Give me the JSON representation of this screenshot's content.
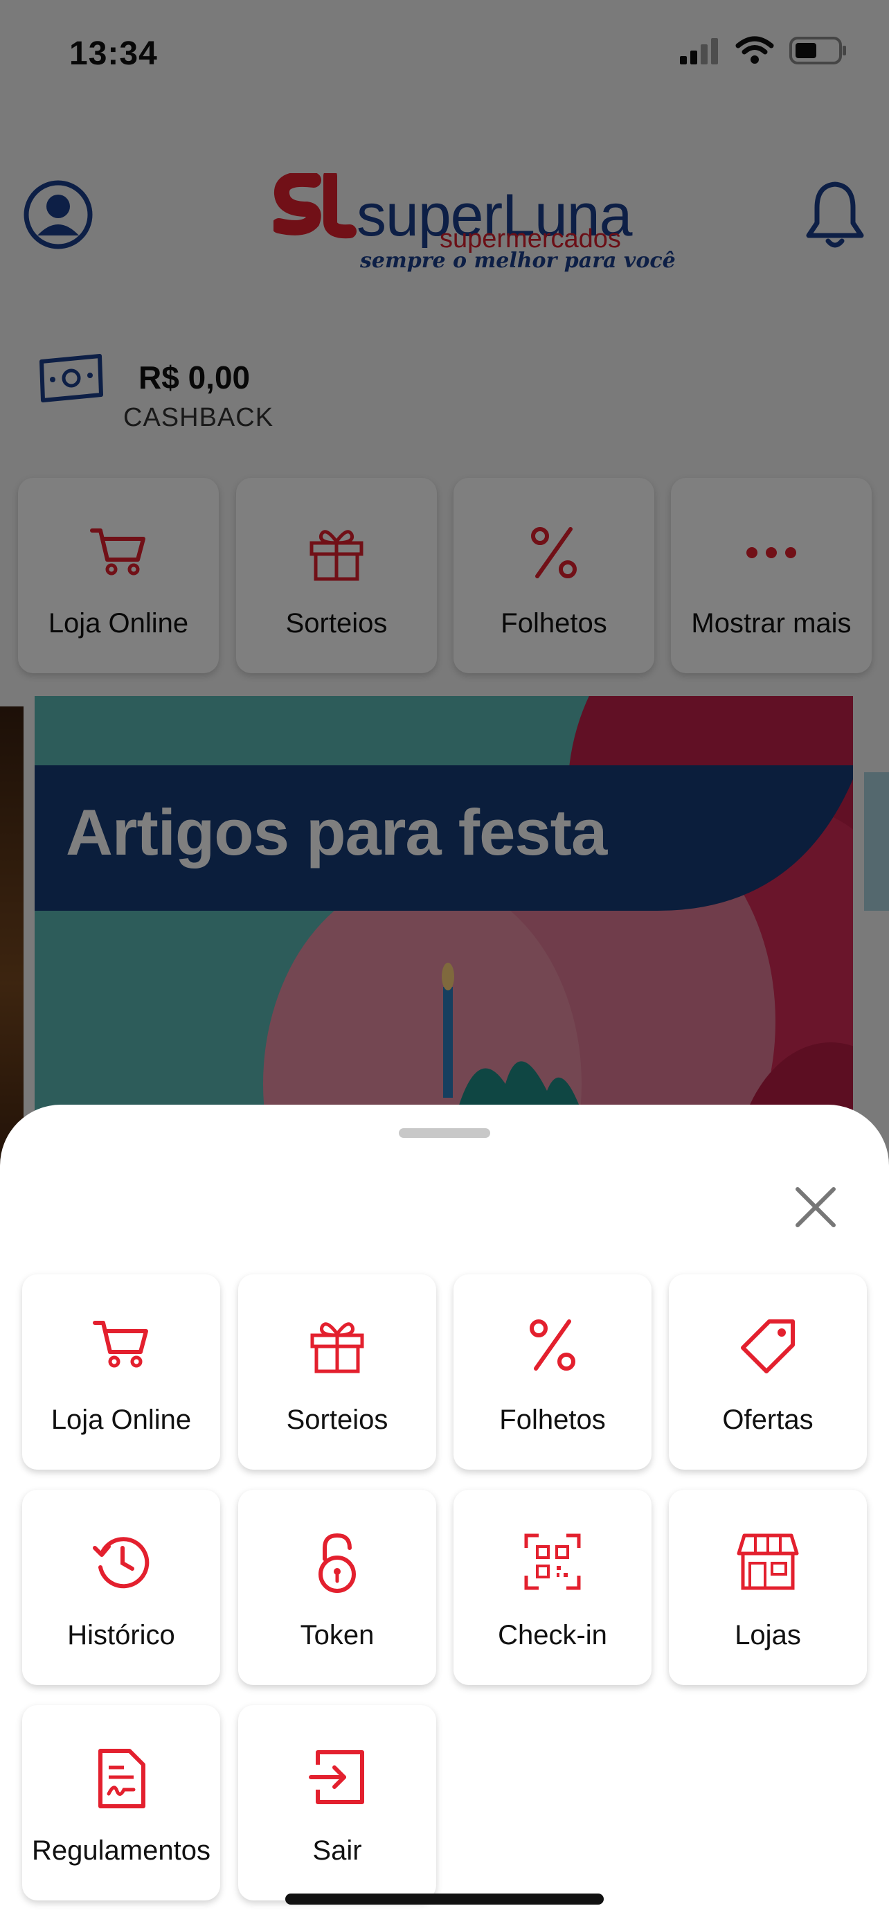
{
  "status_bar": {
    "time": "13:34"
  },
  "header": {
    "logo_name": "superLuna",
    "logo_sub": "supermercados",
    "logo_slogan": "sempre o melhor para você"
  },
  "cashback": {
    "amount": "R$ 0,00",
    "label": "CASHBACK"
  },
  "quick_actions": [
    {
      "label": "Loja Online",
      "icon": "cart-icon"
    },
    {
      "label": "Sorteios",
      "icon": "gift-icon"
    },
    {
      "label": "Folhetos",
      "icon": "percent-icon"
    },
    {
      "label": "Mostrar mais",
      "icon": "more-dots-icon"
    }
  ],
  "banner": {
    "title": "Artigos para festa"
  },
  "sheet": {
    "items": [
      {
        "label": "Loja Online",
        "icon": "cart-icon"
      },
      {
        "label": "Sorteios",
        "icon": "gift-icon"
      },
      {
        "label": "Folhetos",
        "icon": "percent-icon"
      },
      {
        "label": "Ofertas",
        "icon": "tag-icon"
      },
      {
        "label": "Histórico",
        "icon": "history-icon"
      },
      {
        "label": "Token",
        "icon": "unlock-icon"
      },
      {
        "label": "Check-in",
        "icon": "qr-scan-icon"
      },
      {
        "label": "Lojas",
        "icon": "store-icon"
      },
      {
        "label": "Regulamentos",
        "icon": "document-icon"
      },
      {
        "label": "Sair",
        "icon": "logout-icon"
      }
    ]
  },
  "colors": {
    "accent_red": "#e3202e",
    "brand_blue": "#1b3f8c"
  }
}
